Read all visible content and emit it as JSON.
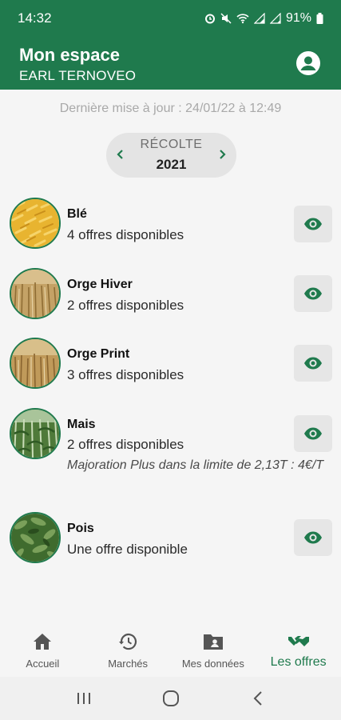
{
  "status_bar": {
    "time": "14:32",
    "battery": "91%"
  },
  "header": {
    "title": "Mon espace",
    "subtitle": "EARL TERNOVEO",
    "account_icon": "account-circle-icon"
  },
  "update_text": "Dernière mise à jour : 24/01/22 à 12:49",
  "harvest": {
    "label": "RÉCOLTE",
    "year": "2021"
  },
  "crops": [
    {
      "name": "Blé",
      "offers": "4 offres disponibles",
      "note": ""
    },
    {
      "name": "Orge Hiver",
      "offers": "2 offres disponibles",
      "note": ""
    },
    {
      "name": "Orge Print",
      "offers": "3 offres disponibles",
      "note": ""
    },
    {
      "name": "Mais",
      "offers": "2 offres disponibles",
      "note": "Majoration Plus dans la limite de  2,13T : 4€/T"
    },
    {
      "name": "Pois",
      "offers": "Une offre disponible",
      "note": ""
    }
  ],
  "bottom_nav": {
    "items": [
      {
        "label": "Accueil",
        "icon": "home-icon"
      },
      {
        "label": "Marchés",
        "icon": "history-icon"
      },
      {
        "label": "Mes données",
        "icon": "folder-account-icon"
      },
      {
        "label": "Les offres",
        "icon": "handshake-icon"
      }
    ],
    "active_index": 3
  },
  "colors": {
    "brand": "#1f7a4d",
    "background": "#f5f5f5"
  }
}
